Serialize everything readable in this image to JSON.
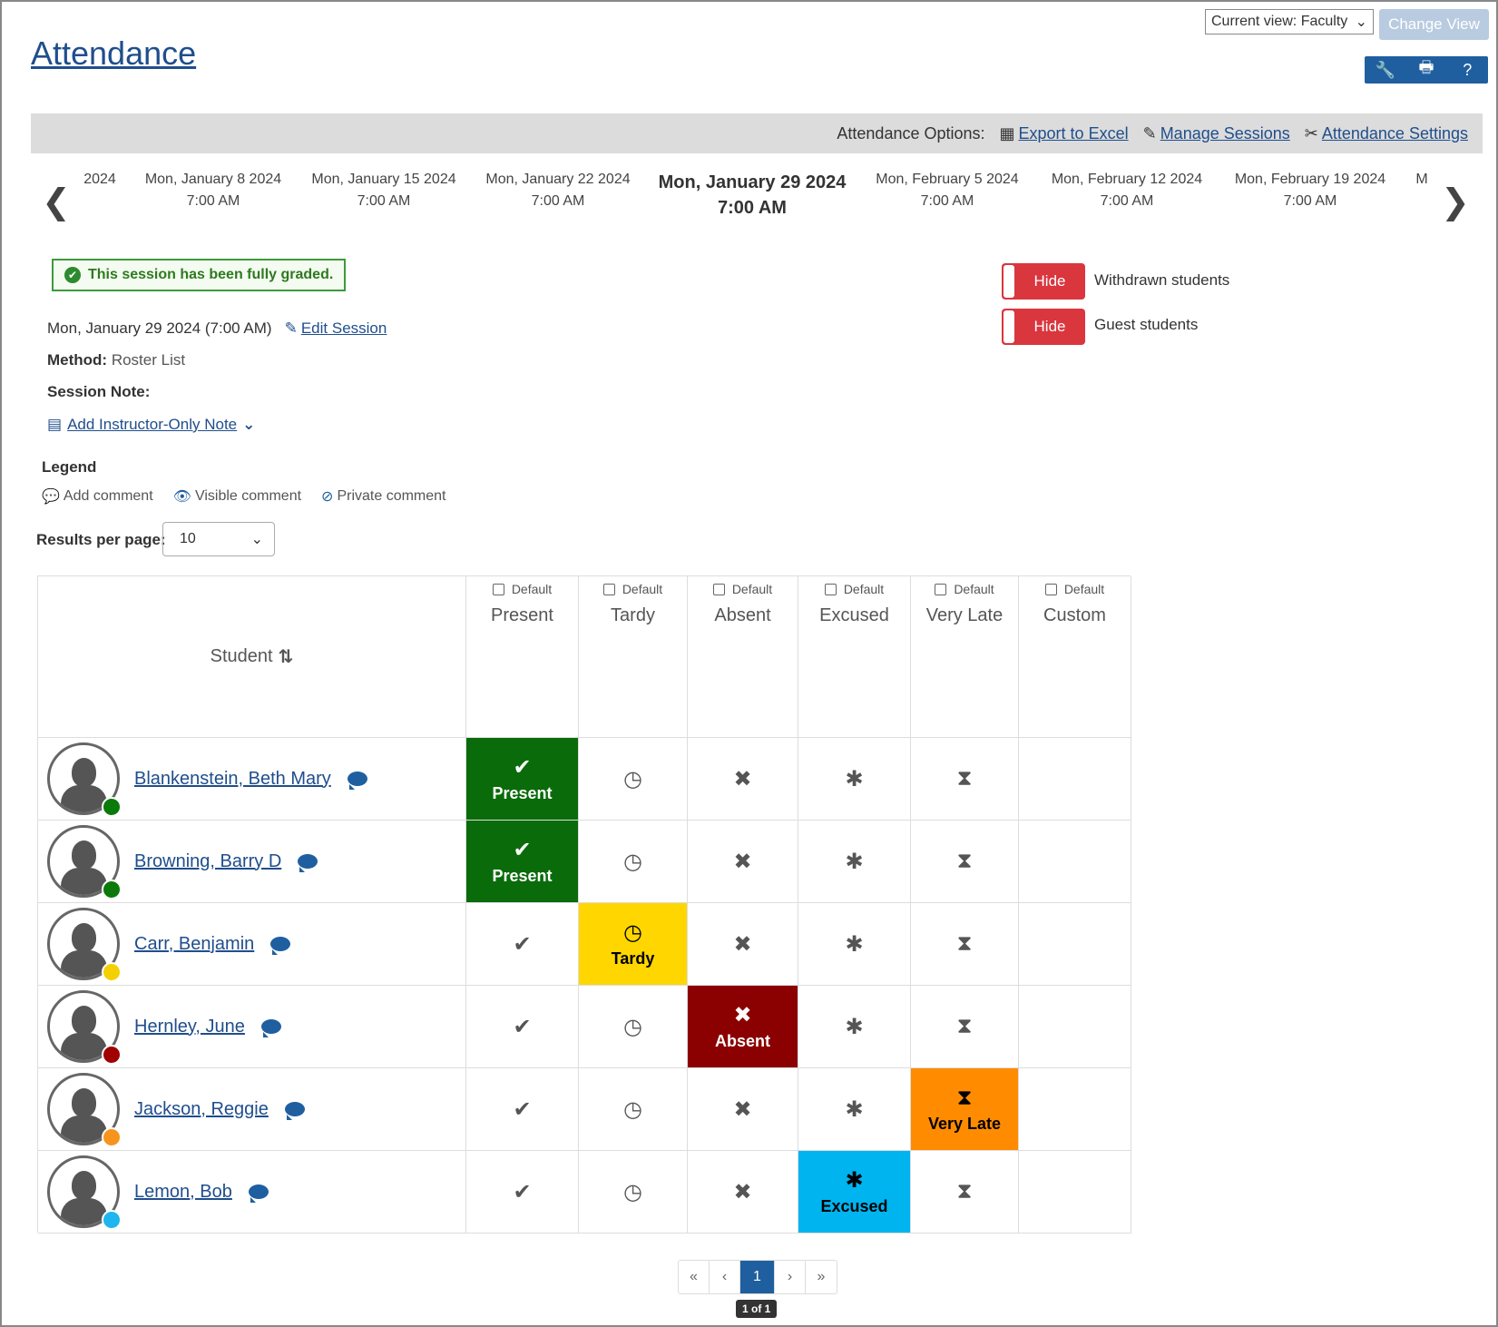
{
  "top": {
    "current_view": "Current view: Faculty",
    "change_view": "Change View"
  },
  "title": "Attendance",
  "options": {
    "label": "Attendance Options:",
    "export": "Export to Excel",
    "manage": "Manage Sessions",
    "settings": "Attendance Settings"
  },
  "sessions": [
    {
      "date": "2024",
      "time": ""
    },
    {
      "date": "Mon, January 8 2024",
      "time": "7:00 AM"
    },
    {
      "date": "Mon, January 15 2024",
      "time": "7:00 AM"
    },
    {
      "date": "Mon, January 22 2024",
      "time": "7:00 AM"
    },
    {
      "date": "Mon, January 29 2024",
      "time": "7:00 AM"
    },
    {
      "date": "Mon, February 5 2024",
      "time": "7:00 AM"
    },
    {
      "date": "Mon, February 12 2024",
      "time": "7:00 AM"
    },
    {
      "date": "Mon, February 19 2024",
      "time": "7:00 AM"
    },
    {
      "date": "M",
      "time": ""
    }
  ],
  "graded_msg": "This session has been fully graded.",
  "session_info": {
    "date": "Mon, January 29 2024 (7:00 AM)",
    "edit": "Edit Session",
    "method_label": "Method:",
    "method": "Roster List",
    "note_label": "Session Note:",
    "add_note": "Add Instructor-Only Note"
  },
  "toggles": [
    {
      "state": "Hide",
      "label": "Withdrawn students"
    },
    {
      "state": "Hide",
      "label": "Guest students"
    }
  ],
  "legend": {
    "title": "Legend",
    "add": "Add comment",
    "visible": "Visible comment",
    "private": "Private comment"
  },
  "rpp": {
    "label": "Results per page:",
    "value": "10"
  },
  "table": {
    "student_header": "Student",
    "default_label": "Default",
    "columns": [
      "Present",
      "Tardy",
      "Absent",
      "Excused",
      "Very Late",
      "Custom"
    ],
    "rows": [
      {
        "name": "Blankenstein, Beth Mary",
        "status": "Present",
        "dot": "#0a7a0a"
      },
      {
        "name": "Browning, Barry D",
        "status": "Present",
        "dot": "#0a7a0a"
      },
      {
        "name": "Carr, Benjamin",
        "status": "Tardy",
        "dot": "#f5d000"
      },
      {
        "name": "Hernley, June",
        "status": "Absent",
        "dot": "#a00000"
      },
      {
        "name": "Jackson, Reggie",
        "status": "Very Late",
        "dot": "#f7941d"
      },
      {
        "name": "Lemon, Bob",
        "status": "Excused",
        "dot": "#1fb5ee"
      }
    ],
    "status_colors": {
      "Present": "#0a6b0a",
      "Tardy": "#ffd600",
      "Absent": "#8b0000",
      "Excused": "#00b4f0",
      "Very Late": "#ff8c00"
    }
  },
  "pager": {
    "first": "«",
    "prev": "‹",
    "current": "1",
    "next": "›",
    "last": "»",
    "badge": "1 of 1"
  }
}
